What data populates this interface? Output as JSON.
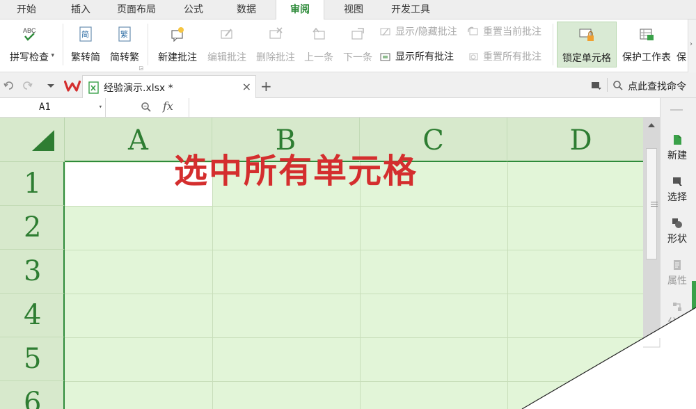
{
  "menu": {
    "tabs": [
      {
        "label": "开始"
      },
      {
        "label": "插入"
      },
      {
        "label": "页面布局"
      },
      {
        "label": "公式"
      },
      {
        "label": "数据"
      },
      {
        "label": "审阅"
      },
      {
        "label": "视图"
      },
      {
        "label": "开发工具"
      }
    ],
    "active_tab": "审阅"
  },
  "ribbon": {
    "spell_check": {
      "icon_text": "ABC",
      "label": "拼写检查"
    },
    "trad_simp": {
      "icon_text": "简",
      "label": "繁转简"
    },
    "simp_trad": {
      "icon_text": "繁",
      "label": "简转繁"
    },
    "new_comment": {
      "label": "新建批注"
    },
    "edit_comment": {
      "label": "编辑批注"
    },
    "delete_comment": {
      "label": "删除批注"
    },
    "prev": {
      "label": "上一条"
    },
    "next": {
      "label": "下一条"
    },
    "show_hide_comment": {
      "label": "显示/隐藏批注"
    },
    "show_all_comments": {
      "label": "显示所有批注"
    },
    "reset_current": {
      "label": "重置当前批注"
    },
    "reset_all": {
      "label": "重置所有批注"
    },
    "lock_cell": {
      "label": "锁定单元格"
    },
    "protect_sheet": {
      "label": "保护工作表"
    },
    "protect_truncated": {
      "label": "保"
    }
  },
  "toolbar": {
    "doc_tab": {
      "name": "经验演示.xlsx *",
      "close": "×"
    },
    "new_tab": "+",
    "find_command": "点此查找命令"
  },
  "formula_bar": {
    "name_box": "A1",
    "fx": "fx",
    "dropdown_glyph": "▾"
  },
  "sheet": {
    "columns": [
      "A",
      "B",
      "C",
      "D"
    ],
    "rows": [
      "1",
      "2",
      "3",
      "4",
      "5",
      "6"
    ],
    "active_cell": "A1"
  },
  "overlay": {
    "text": "选中所有单元格",
    "color": "#d42e2e"
  },
  "side_panel": {
    "items": [
      {
        "label": "新建"
      },
      {
        "label": "选择"
      },
      {
        "label": "形状"
      },
      {
        "label": "属性"
      },
      {
        "label": "分析"
      }
    ]
  },
  "colors": {
    "accent": "#2e8b3a",
    "grid_fill": "#e2f5d8",
    "header_fill": "#d7e9cc"
  }
}
